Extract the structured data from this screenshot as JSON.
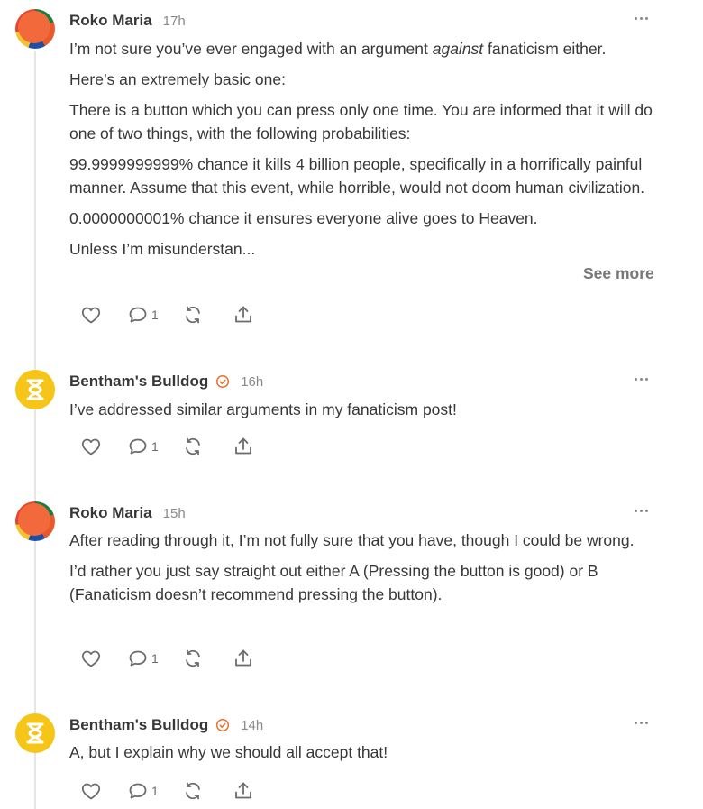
{
  "colors": {
    "accent": "#e8702a",
    "text": "#363737",
    "muted": "#8a8a8a",
    "avatar_bulldog": "#f5c518"
  },
  "comments": [
    {
      "author": "Roko Maria",
      "time": "17h",
      "verified": false,
      "avatar_icon": "colorful-circle-avatar",
      "paragraphs": [
        {
          "pre": "I’m not sure you’ve ever engaged with an argument ",
          "em": "against",
          "post": " fanaticism either."
        },
        {
          "pre": "Here’s an extremely basic one:"
        },
        {
          "pre": "There is a button which you can press only one time. You are informed that it will do one of two things, with the following probabilities:"
        },
        {
          "pre": "99.9999999999% chance it kills 4 billion people, specifically in a horrifically painful manner. Assume that this event, while horrible, would not doom human civilization."
        },
        {
          "pre": "0.0000000001% chance it ensures everyone alive goes to Heaven."
        },
        {
          "pre": "Unless I’m misunderstan..."
        }
      ],
      "see_more": "See more",
      "reply_count": "1"
    },
    {
      "author": "Bentham's Bulldog",
      "time": "16h",
      "verified": true,
      "avatar_icon": "hourglass-avatar",
      "paragraphs": [
        {
          "pre": "I’ve addressed similar arguments in my fanaticism post!"
        }
      ],
      "reply_count": "1"
    },
    {
      "author": "Roko Maria",
      "time": "15h",
      "verified": false,
      "avatar_icon": "colorful-circle-avatar",
      "paragraphs": [
        {
          "pre": "After reading through it, I’m not fully sure that you have, though I could be wrong."
        },
        {
          "pre": "I’d rather you just say straight out either A (Pressing the button is good) or B (Fanaticism doesn’t recommend pressing the button)."
        }
      ],
      "reply_count": "1"
    },
    {
      "author": "Bentham's Bulldog",
      "time": "14h",
      "verified": true,
      "avatar_icon": "hourglass-avatar",
      "paragraphs": [
        {
          "pre": "A, but I explain why we should all accept that!"
        }
      ],
      "reply_count": "1"
    }
  ],
  "icons": {
    "like": "heart-icon",
    "reply": "comment-icon",
    "restack": "restack-icon",
    "share": "share-icon",
    "more": "more-options-icon",
    "verified": "verified-badge-icon"
  }
}
